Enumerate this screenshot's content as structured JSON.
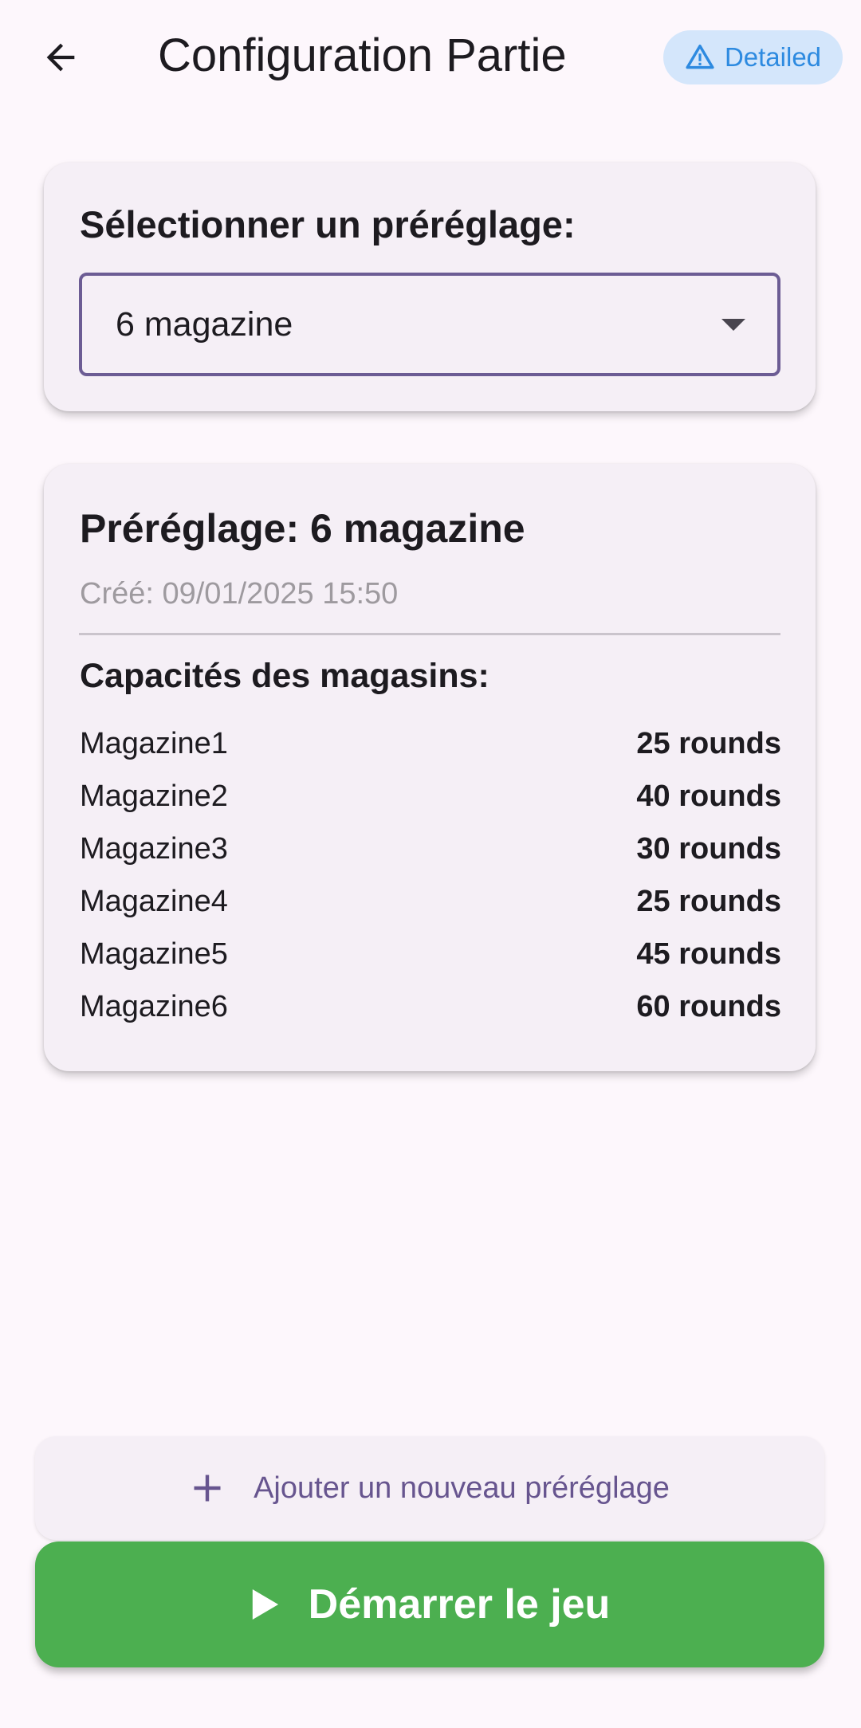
{
  "appbar": {
    "title": "Configuration Partie",
    "back_icon": "arrow-left-icon",
    "badge": {
      "label": "Detailed",
      "icon": "warning-triangle-icon",
      "color": "#2d8ae0",
      "background": "#d4e6fb"
    }
  },
  "preset_selector": {
    "label": "Sélectionner un préréglage:",
    "selected_value": "6 magazine",
    "dropdown_icon": "dropdown-arrow-icon",
    "border_color": "#6c5c94"
  },
  "preset_details": {
    "title": "Préréglage: 6 magazine",
    "created": "Créé: 09/01/2025 15:50",
    "capacities_heading": "Capacités des magasins:",
    "magazines": [
      {
        "name": "Magazine1",
        "value": "25 rounds"
      },
      {
        "name": "Magazine2",
        "value": "40 rounds"
      },
      {
        "name": "Magazine3",
        "value": "30 rounds"
      },
      {
        "name": "Magazine4",
        "value": "25 rounds"
      },
      {
        "name": "Magazine5",
        "value": "45 rounds"
      },
      {
        "name": "Magazine6",
        "value": "60 rounds"
      }
    ]
  },
  "actions": {
    "add_preset_label": "Ajouter un nouveau préréglage",
    "add_icon": "plus-icon",
    "add_color": "#67558f",
    "start_label": "Démarrer le jeu",
    "start_icon": "play-icon",
    "start_color": "#4caf50"
  }
}
